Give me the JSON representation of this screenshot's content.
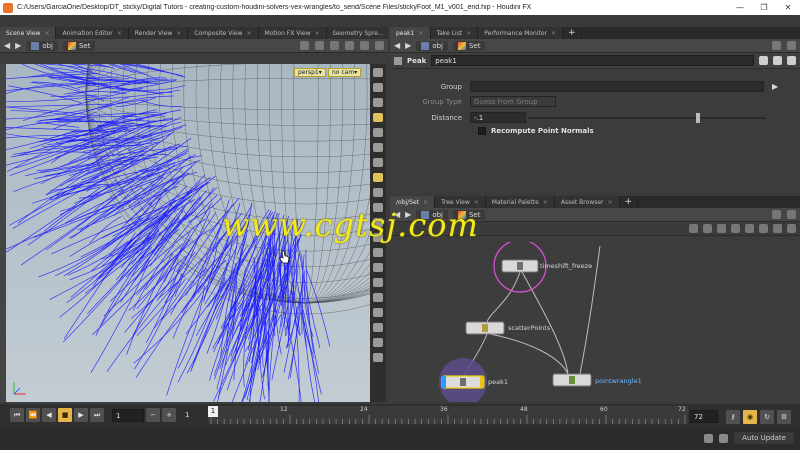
{
  "window": {
    "title": "C:/Users/GarciaOne/Desktop/DT_sticky/Digital Tutors - creating-custom-houdini-solvers-vex-wrangles/to_send/Scene Files/stickyFoot_M1_v001_end.hip - Houdini FX",
    "minimize": "—",
    "maximize": "❐",
    "close": "✕"
  },
  "left_pane": {
    "tabs": [
      {
        "label": "Scene View"
      },
      {
        "label": "Animation Editor"
      },
      {
        "label": "Render View"
      },
      {
        "label": "Composite View"
      },
      {
        "label": "Motion FX View"
      },
      {
        "label": "Geometry Spre..."
      }
    ],
    "path": {
      "context": "obj",
      "node": "Set"
    },
    "camera": {
      "persp": "persp1▾",
      "cam": "no cam▾"
    }
  },
  "right_top_pane": {
    "tabs": [
      {
        "label": "peak1"
      },
      {
        "label": "Take List"
      },
      {
        "label": "Performance Monitor"
      }
    ],
    "path": {
      "context": "obj",
      "node": "Set"
    },
    "node_type": "Peak",
    "node_name": "peak1",
    "params": {
      "group_label": "Group",
      "group_value": "",
      "group_type_label": "Group Type",
      "group_type_value": "Guess from Group",
      "distance_label": "Distance",
      "distance_value": "-.1",
      "distance_fraction": 0.72,
      "recompute_label": "Recompute Point Normals"
    }
  },
  "network_pane": {
    "tabs": [
      {
        "label": "/obj/Set"
      },
      {
        "label": "Tree View"
      },
      {
        "label": "Material Palette"
      },
      {
        "label": "Asset Browser"
      }
    ],
    "path": {
      "context": "obj",
      "node": "Set"
    },
    "nodes": [
      {
        "name": "timeshift_freeze"
      },
      {
        "name": "scatterPoints"
      },
      {
        "name": "peak1"
      },
      {
        "name": "pointwrangle1"
      }
    ]
  },
  "timeline": {
    "start": "1",
    "current": "1",
    "frame_marker": "1",
    "ticks": [
      "12",
      "24",
      "36",
      "48",
      "60",
      "72"
    ],
    "end": "72"
  },
  "status": {
    "auto_update": "Auto Update"
  },
  "watermark": "www.cgtsj.com",
  "colors": {
    "accent": "#e6b54a",
    "curve": "#1a1aff",
    "watermark": "#f2ea1e"
  }
}
